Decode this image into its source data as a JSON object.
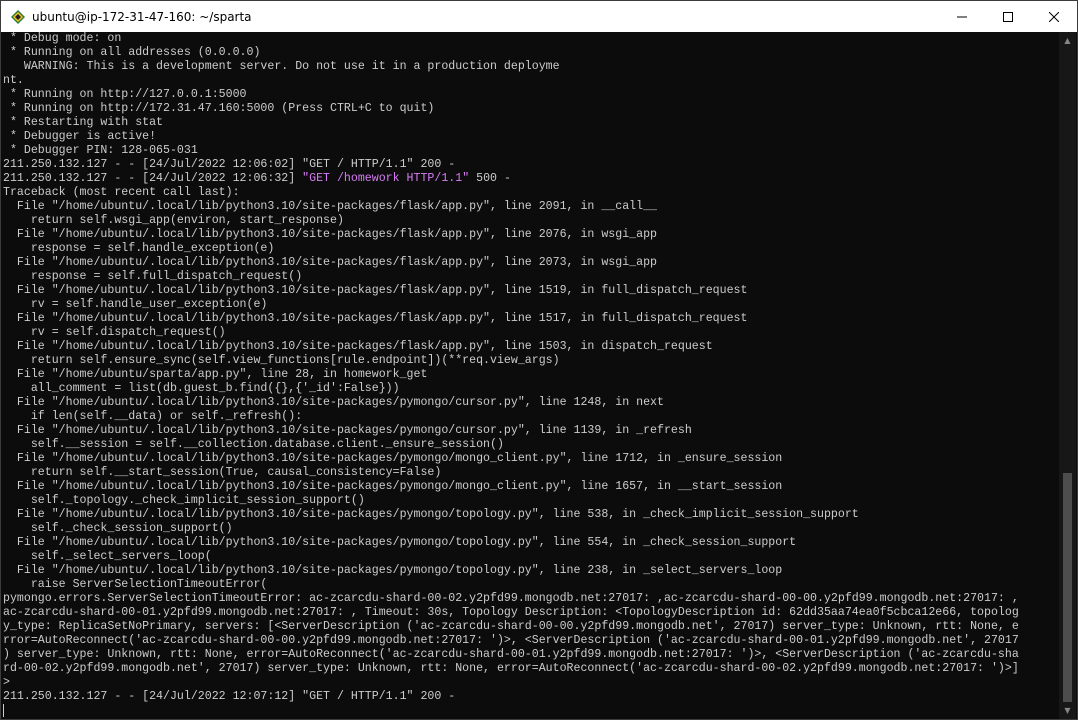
{
  "window": {
    "title": "ubuntu@ip-172-31-47-160: ~/sparta",
    "icon": "terminal-penguin-icon",
    "buttons": {
      "minimize": "minimize-icon",
      "maximize": "maximize-icon",
      "close": "close-icon"
    }
  },
  "colors": {
    "background": "#0c0c0c",
    "text": "#cccccc",
    "highlight": "#d77bf5"
  },
  "terminal": {
    "lines": [
      {
        "text": " * Debug mode: on"
      },
      {
        "text": " * Running on all addresses (0.0.0.0)"
      },
      {
        "text": "   WARNING: This is a development server. Do not use it in a production deployme"
      },
      {
        "text": "nt."
      },
      {
        "text": " * Running on http://127.0.0.1:5000"
      },
      {
        "text": " * Running on http://172.31.47.160:5000 (Press CTRL+C to quit)"
      },
      {
        "text": " * Restarting with stat"
      },
      {
        "text": " * Debugger is active!"
      },
      {
        "text": " * Debugger PIN: 128-065-031"
      },
      {
        "text": "211.250.132.127 - - [24/Jul/2022 12:06:02] \"GET / HTTP/1.1\" 200 -"
      },
      {
        "pre": "211.250.132.127 - - [24/Jul/2022 12:06:32] ",
        "hl": "\"GET /homework HTTP/1.1\"",
        "post": " 500 -"
      },
      {
        "text": "Traceback (most recent call last):"
      },
      {
        "text": "  File \"/home/ubuntu/.local/lib/python3.10/site-packages/flask/app.py\", line 2091, in __call__"
      },
      {
        "text": "    return self.wsgi_app(environ, start_response)"
      },
      {
        "text": "  File \"/home/ubuntu/.local/lib/python3.10/site-packages/flask/app.py\", line 2076, in wsgi_app"
      },
      {
        "text": "    response = self.handle_exception(e)"
      },
      {
        "text": "  File \"/home/ubuntu/.local/lib/python3.10/site-packages/flask/app.py\", line 2073, in wsgi_app"
      },
      {
        "text": "    response = self.full_dispatch_request()"
      },
      {
        "text": "  File \"/home/ubuntu/.local/lib/python3.10/site-packages/flask/app.py\", line 1519, in full_dispatch_request"
      },
      {
        "text": "    rv = self.handle_user_exception(e)"
      },
      {
        "text": "  File \"/home/ubuntu/.local/lib/python3.10/site-packages/flask/app.py\", line 1517, in full_dispatch_request"
      },
      {
        "text": "    rv = self.dispatch_request()"
      },
      {
        "text": "  File \"/home/ubuntu/.local/lib/python3.10/site-packages/flask/app.py\", line 1503, in dispatch_request"
      },
      {
        "text": "    return self.ensure_sync(self.view_functions[rule.endpoint])(**req.view_args)"
      },
      {
        "text": "  File \"/home/ubuntu/sparta/app.py\", line 28, in homework_get"
      },
      {
        "text": "    all_comment = list(db.guest_b.find({},{'_id':False}))"
      },
      {
        "text": "  File \"/home/ubuntu/.local/lib/python3.10/site-packages/pymongo/cursor.py\", line 1248, in next"
      },
      {
        "text": "    if len(self.__data) or self._refresh():"
      },
      {
        "text": "  File \"/home/ubuntu/.local/lib/python3.10/site-packages/pymongo/cursor.py\", line 1139, in _refresh"
      },
      {
        "text": "    self.__session = self.__collection.database.client._ensure_session()"
      },
      {
        "text": "  File \"/home/ubuntu/.local/lib/python3.10/site-packages/pymongo/mongo_client.py\", line 1712, in _ensure_session"
      },
      {
        "text": "    return self.__start_session(True, causal_consistency=False)"
      },
      {
        "text": "  File \"/home/ubuntu/.local/lib/python3.10/site-packages/pymongo/mongo_client.py\", line 1657, in __start_session"
      },
      {
        "text": "    self._topology._check_implicit_session_support()"
      },
      {
        "text": "  File \"/home/ubuntu/.local/lib/python3.10/site-packages/pymongo/topology.py\", line 538, in _check_implicit_session_support"
      },
      {
        "text": "    self._check_session_support()"
      },
      {
        "text": "  File \"/home/ubuntu/.local/lib/python3.10/site-packages/pymongo/topology.py\", line 554, in _check_session_support"
      },
      {
        "text": "    self._select_servers_loop("
      },
      {
        "text": "  File \"/home/ubuntu/.local/lib/python3.10/site-packages/pymongo/topology.py\", line 238, in _select_servers_loop"
      },
      {
        "text": "    raise ServerSelectionTimeoutError("
      },
      {
        "text": "pymongo.errors.ServerSelectionTimeoutError: ac-zcarcdu-shard-00-02.y2pfd99.mongodb.net:27017: ,ac-zcarcdu-shard-00-00.y2pfd99.mongodb.net:27017: ,"
      },
      {
        "text": "ac-zcarcdu-shard-00-01.y2pfd99.mongodb.net:27017: , Timeout: 30s, Topology Description: <TopologyDescription id: 62dd35aa74ea0f5cbca12e66, topolog"
      },
      {
        "text": "y_type: ReplicaSetNoPrimary, servers: [<ServerDescription ('ac-zcarcdu-shard-00-00.y2pfd99.mongodb.net', 27017) server_type: Unknown, rtt: None, e"
      },
      {
        "text": "rror=AutoReconnect('ac-zcarcdu-shard-00-00.y2pfd99.mongodb.net:27017: ')>, <ServerDescription ('ac-zcarcdu-shard-00-01.y2pfd99.mongodb.net', 27017"
      },
      {
        "text": ") server_type: Unknown, rtt: None, error=AutoReconnect('ac-zcarcdu-shard-00-01.y2pfd99.mongodb.net:27017: ')>, <ServerDescription ('ac-zcarcdu-sha"
      },
      {
        "text": "rd-00-02.y2pfd99.mongodb.net', 27017) server_type: Unknown, rtt: None, error=AutoReconnect('ac-zcarcdu-shard-00-02.y2pfd99.mongodb.net:27017: ')>]"
      },
      {
        "text": ">"
      },
      {
        "text": "211.250.132.127 - - [24/Jul/2022 12:07:12] \"GET / HTTP/1.1\" 200 -"
      }
    ]
  }
}
